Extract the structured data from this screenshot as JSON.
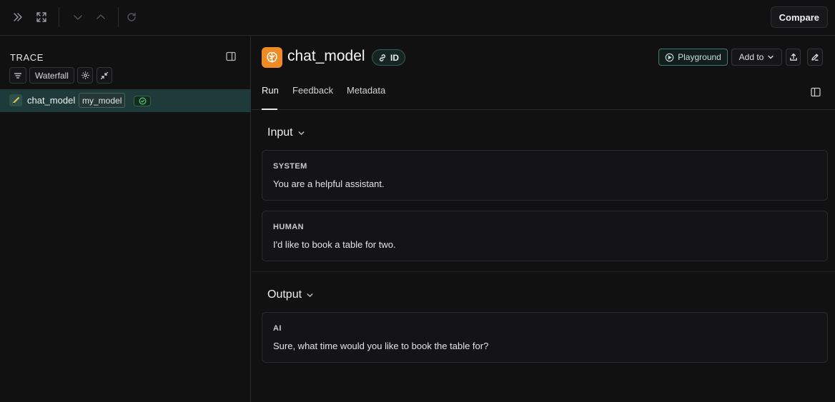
{
  "toolbar": {
    "compare_label": "Compare",
    "icons": [
      "chevrons-right-icon",
      "expand-icon",
      "chevron-down-icon",
      "chevron-up-icon",
      "refresh-icon"
    ]
  },
  "trace_panel": {
    "title": "TRACE",
    "view_label": "Waterfall",
    "row": {
      "name": "chat_model",
      "tag": "my_model",
      "status": "success"
    }
  },
  "run": {
    "title": "chat_model",
    "id_label": "ID",
    "playground_label": "Playground",
    "add_to_label": "Add to",
    "tabs": [
      {
        "label": "Run",
        "active": true
      },
      {
        "label": "Feedback",
        "active": false
      },
      {
        "label": "Metadata",
        "active": false
      }
    ],
    "input": {
      "title": "Input",
      "messages": [
        {
          "role": "SYSTEM",
          "text": "You are a helpful assistant."
        },
        {
          "role": "HUMAN",
          "text": "I'd like to book a table for two."
        }
      ]
    },
    "output": {
      "title": "Output",
      "messages": [
        {
          "role": "AI",
          "text": "Sure, what time would you like to book the table for?"
        }
      ]
    }
  },
  "colors": {
    "accent_orange": "#f08a24",
    "selected_row": "#1e3a3a",
    "success_green": "#4fd17d"
  }
}
